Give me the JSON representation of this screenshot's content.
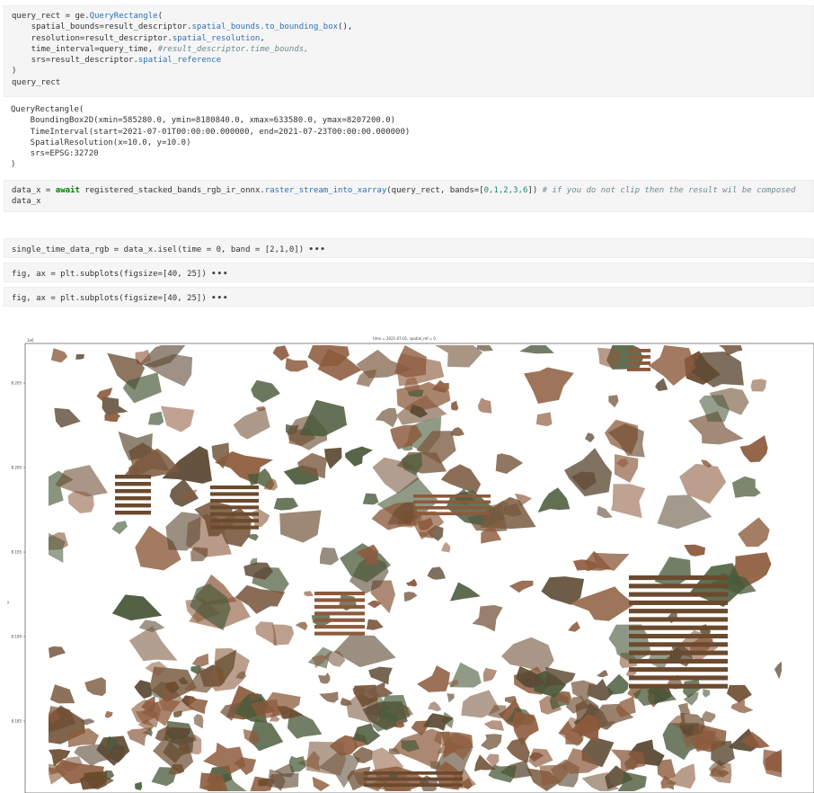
{
  "cells": {
    "query_rect_input": {
      "line1_pre": "query_rect = ge.",
      "line1_fn": "QueryRectangle",
      "line1_post": "(",
      "line2_pre": "    spatial_bounds=result_descriptor.",
      "line2_fn": "spatial_bounds.to_bounding_box",
      "line2_post": "(),",
      "line3_pre": "    resolution=result_descriptor.",
      "line3_fn": "spatial_resolution",
      "line3_post": ",",
      "line4_pre": "    time_interval=query_time, ",
      "line4_comment": "#result_descriptor.time_bounds,",
      "line5_pre": "    srs=result_descriptor.",
      "line5_fn": "spatial_reference",
      "line6": ")",
      "line7": "query_rect"
    },
    "query_rect_output": {
      "line1": "QueryRectangle(",
      "line2": "    BoundingBox2D(xmin=585280.0, ymin=8180840.0, xmax=633580.0, ymax=8207200.0)",
      "line3": "    TimeInterval(start=2021-07-01T00:00:00.000000, end=2021-07-23T00:00:00.000000)",
      "line4": "    SpatialResolution(x=10.0, y=10.0)",
      "line5": "    srs=EPSG:32720",
      "line6": ")"
    },
    "data_x_input": {
      "pre": "data_x = ",
      "kw": "await",
      "mid": " registered_stacked_bands_rgb_ir_onnx.",
      "fn": "raster_stream_into_xarray",
      "args1": "(query_rect, bands=[",
      "bands": "0,1,2,3,6",
      "args2": "]) ",
      "comment": "# if you do not clip then the result wil be composed",
      "line2": "data_x"
    },
    "collapsed": [
      {
        "code": "single_time_data_rgb = data_x.isel(time = 0, band = [2,1,0])",
        "dots": "•••"
      },
      {
        "code": "fig, ax = plt.subplots(figsize=[40, 25])",
        "dots": "•••"
      },
      {
        "code": "fig, ax = plt.subplots(figsize=[40, 25])",
        "dots": "•••"
      }
    ]
  },
  "plot": {
    "title": "time = 2021-07-01, spatial_ref = 0",
    "corner_label": "1e6",
    "ylabel": "y",
    "y_ticks": [
      "8.205",
      "8.200",
      "8.195",
      "8.190",
      "8.185"
    ],
    "colors": {
      "field_brown": "#8c5a3c",
      "field_dark": "#6b4a2e",
      "veg_green": "#4a5a3a",
      "background": "#ffffff"
    }
  }
}
